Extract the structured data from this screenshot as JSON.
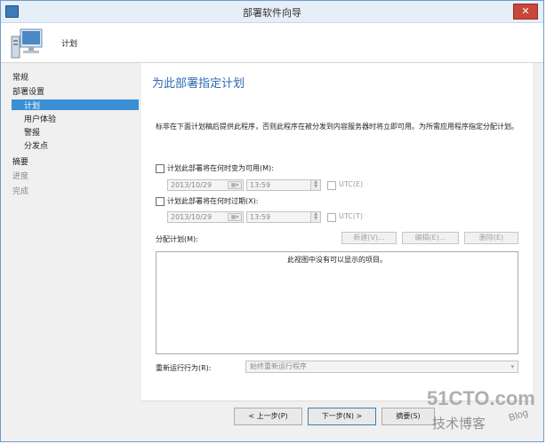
{
  "window": {
    "title": "部署软件向导",
    "close_glyph": "✕"
  },
  "header": {
    "title": "计划",
    "icon": "computer-icon"
  },
  "nav": {
    "items": [
      {
        "label": "常规",
        "state": "normal"
      },
      {
        "label": "部署设置",
        "state": "normal"
      },
      {
        "label": "计划",
        "state": "selected"
      },
      {
        "label": "用户体验",
        "state": "normal"
      },
      {
        "label": "警报",
        "state": "normal"
      },
      {
        "label": "分发点",
        "state": "normal"
      },
      {
        "label": "摘要",
        "state": "normal"
      },
      {
        "label": "进度",
        "state": "disabled"
      },
      {
        "label": "完成",
        "state": "disabled"
      }
    ]
  },
  "content": {
    "heading": "为此部署指定计划",
    "description": "标非在下面计划稿后提供此程序，否则此程序在被分发到内容服务器时将立即可用。为所需应用程序指定分配计划。",
    "available": {
      "label": "计划此部署将在何时变为可用(M):",
      "checked": false,
      "date": "2013/10/29",
      "time": "13:59",
      "utc_label": "UTC(E)",
      "utc_checked": false
    },
    "expire": {
      "label": "计划此部署将在何时过期(X):",
      "checked": false,
      "date": "2013/10/29",
      "time": "13:59",
      "utc_label": "UTC(T)",
      "utc_checked": false
    },
    "assignment": {
      "label": "分配计划(M):",
      "new_button": "新建(V)...",
      "edit_button": "编辑(E)...",
      "delete_button": "删除(E)",
      "empty_text": "此视图中没有可以显示的项目。"
    },
    "rerun": {
      "label": "重新运行行为(R):",
      "value": "始终重新运行程序"
    }
  },
  "footer": {
    "prev_button": "< 上一步(P)",
    "next_button": "下一步(N) >",
    "summary_button": "摘要(S)"
  },
  "watermark": {
    "main": "51CTO.com",
    "sub": "技术博客",
    "blog": "Blog"
  },
  "colors": {
    "accent": "#2c6cb0",
    "selection": "#3b8fd4",
    "window_border": "#6a9ccf"
  }
}
